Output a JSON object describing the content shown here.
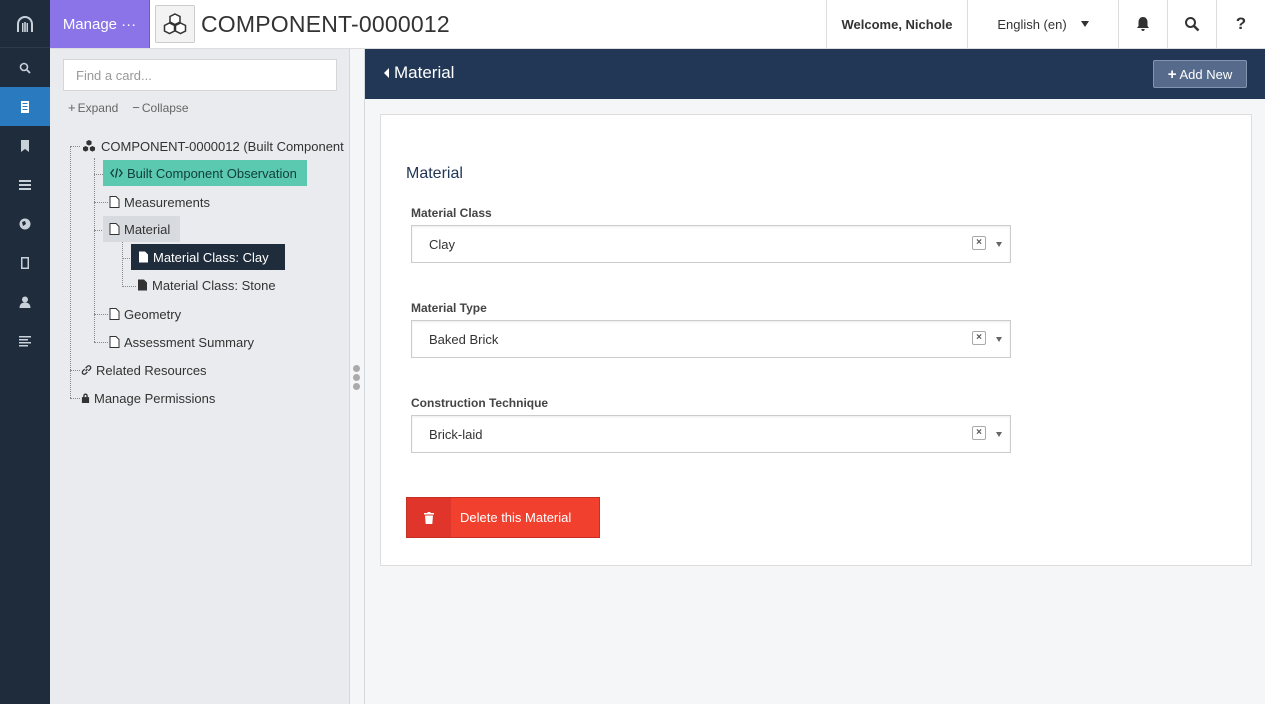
{
  "app": {
    "manage_label": "Manage ···",
    "resource_title": "COMPONENT-0000012"
  },
  "header": {
    "welcome": "Welcome, Nichole",
    "language": "English (en)",
    "help": "?"
  },
  "rail": {
    "icons": [
      "archive-logo-icon",
      "search-icon",
      "resource-icon",
      "bookmark-icon",
      "list-icon",
      "globe-icon",
      "file-icon",
      "user-icon",
      "menu-icon"
    ],
    "active_index": 1,
    "active_color": "#2a7ac0"
  },
  "tree": {
    "search_placeholder": "Find a card...",
    "expand": "Expand",
    "collapse": "Collapse",
    "root": "COMPONENT-0000012 (Built Component",
    "items": {
      "observation": "Built Component Observation",
      "measurements": "Measurements",
      "material": "Material",
      "clay": "Material Class: Clay",
      "stone": "Material Class: Stone",
      "geometry": "Geometry",
      "assessment": "Assessment Summary",
      "related": "Related Resources",
      "permissions": "Manage Permissions"
    }
  },
  "main": {
    "header_title": "Material",
    "add_new": "Add New",
    "card_title": "Material",
    "fields": [
      {
        "label": "Material Class",
        "value": "Clay"
      },
      {
        "label": "Material Type",
        "value": "Baked Brick"
      },
      {
        "label": "Construction Technique",
        "value": "Brick-laid"
      }
    ],
    "delete_label": "Delete this Material"
  },
  "colors": {
    "manage_bg": "#8a74e8",
    "header_bg": "#223656",
    "selected_card": "#5bc8b0",
    "delete_bg": "#f2402f"
  }
}
